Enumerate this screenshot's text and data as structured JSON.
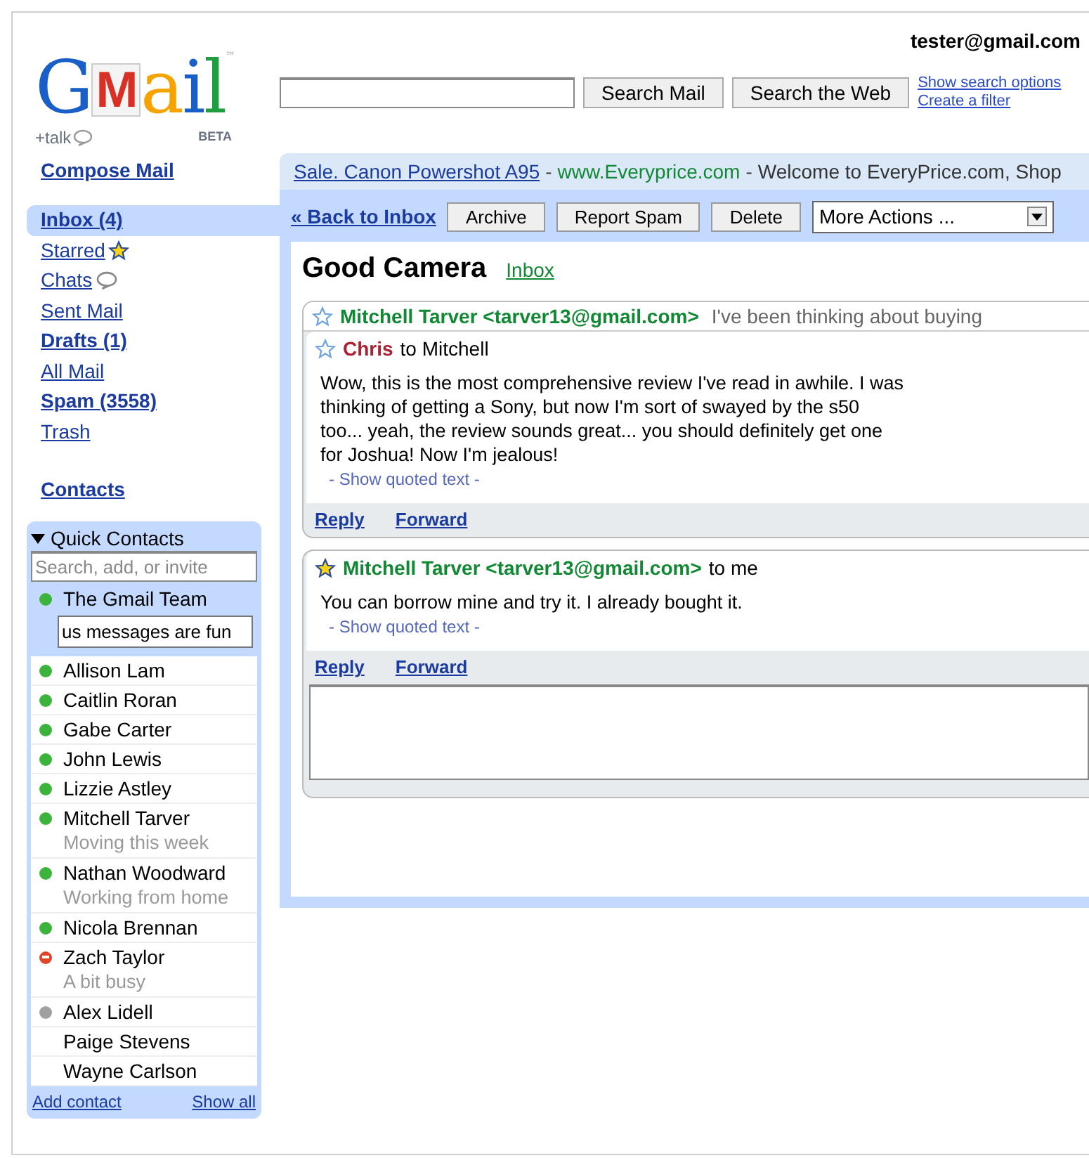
{
  "account": "tester@gmail.com",
  "logo": {
    "letters": [
      "G",
      "M",
      "a",
      "i",
      "l"
    ],
    "trademark": "™",
    "talk": "+talk",
    "beta": "BETA"
  },
  "search": {
    "buttons": [
      "Search Mail",
      "Search the Web"
    ],
    "links": [
      "Show search options",
      "Create a filter"
    ]
  },
  "compose": "Compose Mail",
  "nav": [
    {
      "label": "Inbox (4)",
      "selected": true,
      "unread": true,
      "kind": "plain"
    },
    {
      "label": "Starred",
      "selected": false,
      "unread": false,
      "kind": "starred"
    },
    {
      "label": "Chats",
      "selected": false,
      "unread": false,
      "kind": "chats"
    },
    {
      "label": "Sent Mail",
      "selected": false,
      "unread": false,
      "kind": "plain"
    },
    {
      "label": "Drafts (1)",
      "selected": false,
      "unread": true,
      "kind": "plain"
    },
    {
      "label": "All Mail",
      "selected": false,
      "unread": false,
      "kind": "plain"
    },
    {
      "label": "Spam (3558)",
      "selected": false,
      "unread": true,
      "kind": "plain"
    },
    {
      "label": "Trash",
      "selected": false,
      "unread": false,
      "kind": "plain"
    }
  ],
  "contacts_link": "Contacts",
  "quick_contacts": {
    "title": "Quick Contacts",
    "expanded": true,
    "search_placeholder": "Search, add, or invite",
    "me": {
      "name": "The Gmail Team",
      "kind": "available",
      "status_message": "us messages are fun"
    },
    "contacts": [
      {
        "name": "Allison Lam",
        "kind": "available"
      },
      {
        "name": "Caitlin Roran",
        "kind": "available"
      },
      {
        "name": "Gabe Carter",
        "kind": "available"
      },
      {
        "name": "John Lewis",
        "kind": "available"
      },
      {
        "name": "Lizzie Astley",
        "kind": "available"
      },
      {
        "name": "Mitchell Tarver",
        "kind": "available",
        "note": "Moving this week"
      },
      {
        "name": "Nathan Woodward",
        "kind": "available",
        "note": "Working from home"
      },
      {
        "name": "Nicola Brennan",
        "kind": "available"
      },
      {
        "name": "Zach Taylor",
        "kind": "busy",
        "note": "A bit busy"
      },
      {
        "name": "Alex Lidell",
        "kind": "idle"
      },
      {
        "name": "Paige Stevens",
        "kind": "offline"
      },
      {
        "name": "Wayne Carlson",
        "kind": "offline"
      }
    ],
    "footer_links": [
      "Add contact",
      "Show all"
    ]
  },
  "ad": {
    "link": "Sale. Canon Powershot A95",
    "separators": [
      "-",
      "-"
    ],
    "url": "www.Everyprice.com",
    "text": "Welcome to EveryPrice.com, Shop"
  },
  "toolbar": {
    "back": "« Back to Inbox",
    "buttons": [
      "Archive",
      "Report Spam",
      "Delete"
    ],
    "more": "More Actions ..."
  },
  "subject": "Good Camera",
  "label": "Inbox",
  "cards": [
    {
      "messages": [
        {
          "kind": "collapsed",
          "starred": false,
          "sender": "Mitchell Tarver <tarver13@gmail.com>",
          "color": "#118833",
          "snippet": "I've been thinking about buying"
        },
        {
          "kind": "expanded",
          "starred": false,
          "sender": "Chris",
          "color": "#aa2233",
          "recipient": "to Mitchell",
          "body": "Wow, this is the most comprehensive review I've read in awhile.  I was\nthinking of getting a Sony, but now I'm sort of swayed by the s50\ntoo...  yeah, the review sounds great... you should definitely get one\nfor Joshua!  Now I'm jealous!",
          "quoted": "- Show quoted text -"
        }
      ],
      "actions": [
        "Reply",
        "Forward"
      ],
      "reply_box": false
    },
    {
      "messages": [
        {
          "kind": "expanded",
          "starred": true,
          "sender": "Mitchell Tarver <tarver13@gmail.com>",
          "color": "#118833",
          "recipient": "to me",
          "body": "You can borrow mine and try it. I already bought it.",
          "quoted": "- Show quoted text -"
        }
      ],
      "actions": [
        "Reply",
        "Forward"
      ],
      "reply_box": true
    }
  ]
}
